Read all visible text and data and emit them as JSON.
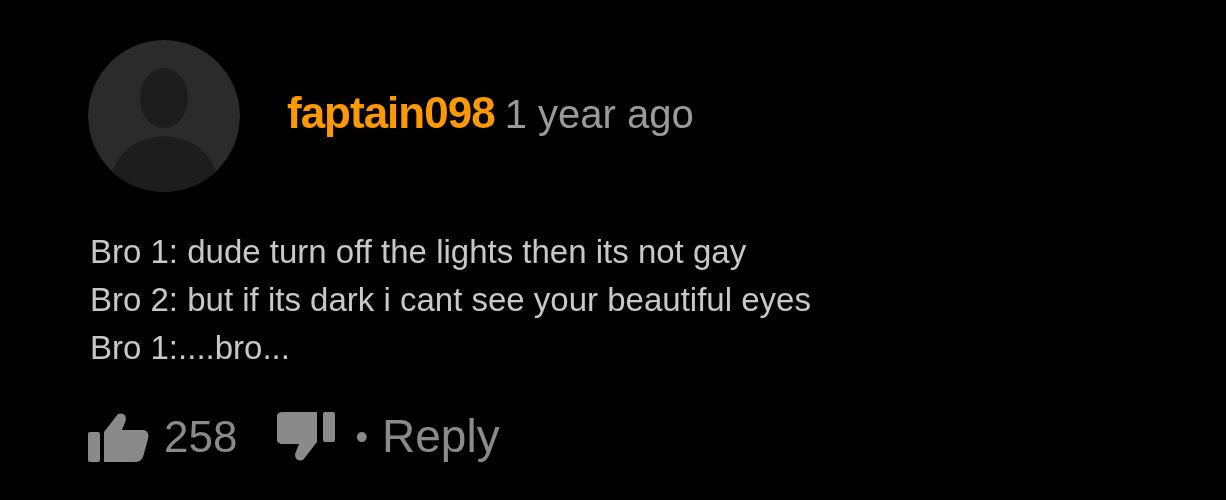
{
  "comment": {
    "username": "faptain098",
    "time": "1 year ago",
    "lines": [
      "Bro 1: dude turn off the lights then its not gay",
      "Bro 2: but if its dark i cant see your beautiful eyes",
      "Bro 1:....bro..."
    ],
    "likes": "258",
    "separator": "•",
    "reply": "Reply"
  }
}
